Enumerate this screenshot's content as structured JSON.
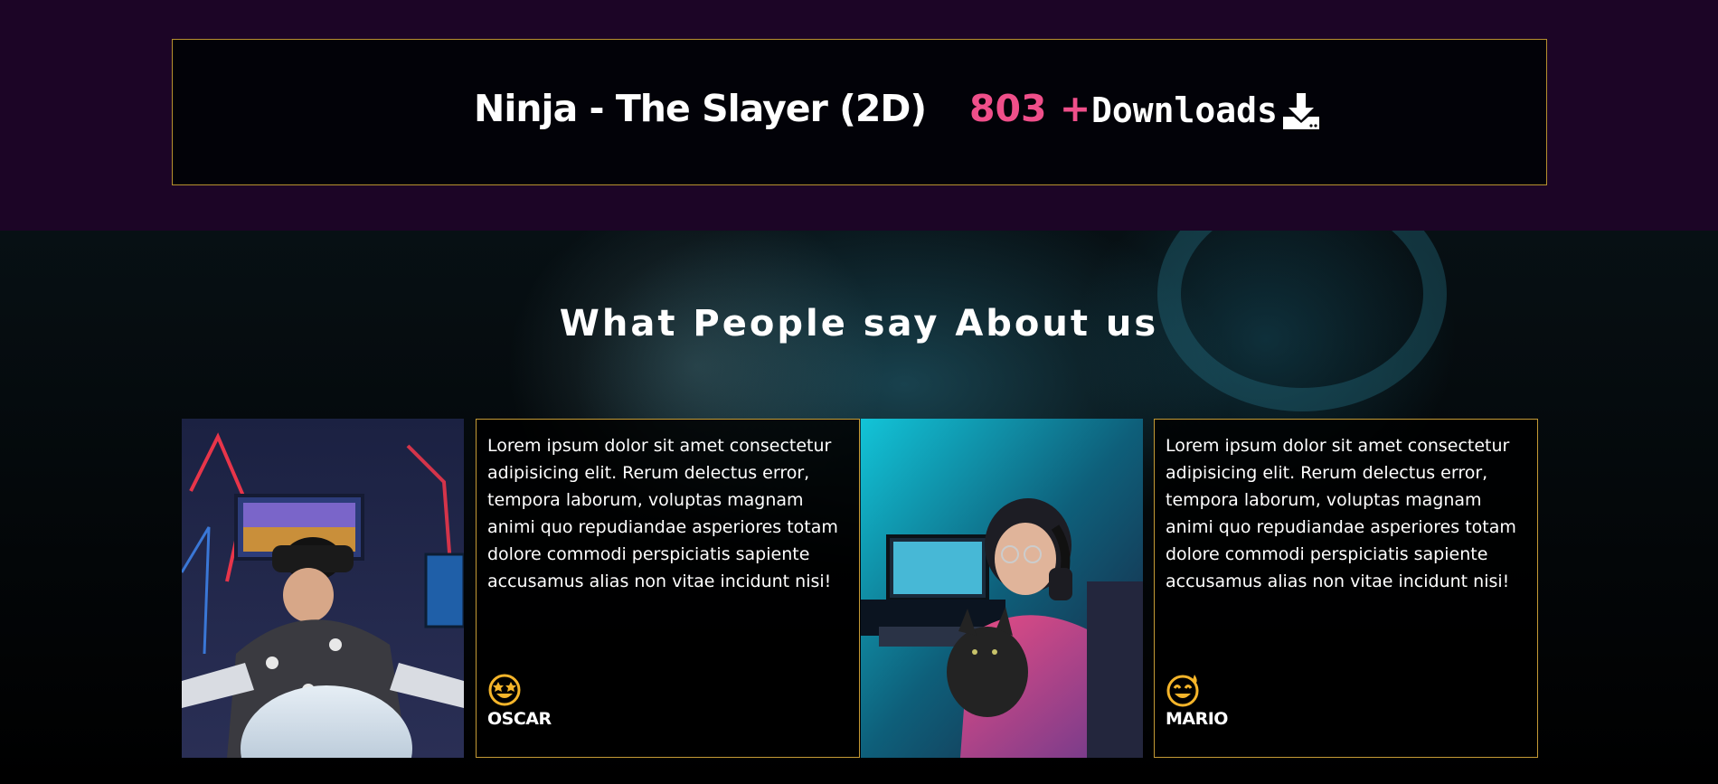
{
  "banner": {
    "title": "Ninja - The Slayer (2D)",
    "download_count": "803 +",
    "download_label": "Downloads",
    "download_icon": "download-icon"
  },
  "section": {
    "title": "What People say About us"
  },
  "testimonials": [
    {
      "photo": "vr-gamer-photo",
      "text": "Lorem ipsum dolor sit amet consectetur adipisicing elit. Rerum delectus error, tempora laborum, voluptas magnam animi quo repudiandae asperiores totam dolore commodi perspiciatis sapiente accusamus alias non vitae incidunt nisi!",
      "icon": "grin-stars-icon",
      "name": "OSCAR"
    },
    {
      "photo": "gamer-with-cat-photo",
      "text": "Lorem ipsum dolor sit amet consectetur adipisicing elit. Rerum delectus error, tempora laborum, voluptas magnam animi quo repudiandae asperiores totam dolore commodi perspiciatis sapiente accusamus alias non vitae incidunt nisi!",
      "icon": "grin-beam-sweat-icon",
      "name": "MARIO"
    }
  ],
  "colors": {
    "top_band": "#1c0526",
    "accent_pink": "#ef4f8a",
    "gold_border": "#c49a35",
    "emoji_yellow": "#f5b52a"
  }
}
